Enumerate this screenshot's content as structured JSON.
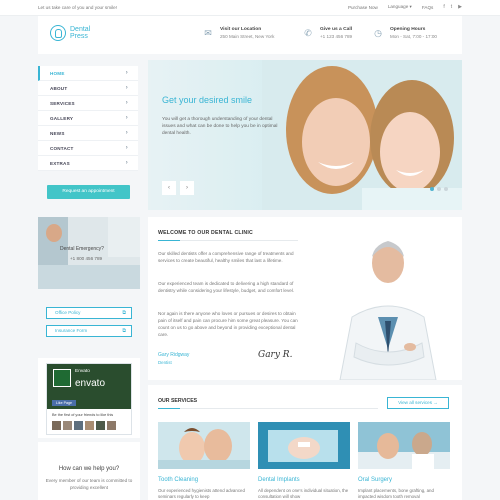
{
  "topbar": {
    "tagline": "Let us take care of you and your smile!",
    "purchase": "Purchase Now",
    "language": "Language",
    "faqs": "FAQs"
  },
  "header": {
    "logo_line1": "Dental",
    "logo_line2": "Press",
    "location_title": "Visit our Location",
    "location_value": "250 Main Street, New York",
    "call_title": "Give us a Call",
    "call_value": "+1 123 456 789",
    "hours_title": "Opening Hours",
    "hours_value": "Mon - Sat, 7:00 - 17:00"
  },
  "nav": {
    "items": [
      {
        "label": "HOME"
      },
      {
        "label": "ABOUT"
      },
      {
        "label": "SERVICES"
      },
      {
        "label": "GALLERY"
      },
      {
        "label": "NEWS"
      },
      {
        "label": "CONTACT"
      },
      {
        "label": "EXTRAS"
      }
    ]
  },
  "appointment_label": "Request an appointment",
  "slider": {
    "heading": "Get your desired smile",
    "text": "You will get a thorough understanding of your dental issues and what can be done to help you be in optimal dental health.",
    "slide_current": 1,
    "slide_total": 3
  },
  "emergency": {
    "label": "Dental Emergency?",
    "phone": "+1 800 456 789"
  },
  "links": {
    "office_policy": "Office Policy",
    "insurance_form": "Insurance Form"
  },
  "facebook": {
    "page_name": "Envato",
    "cover_text": "envato",
    "like_label": "Like Page",
    "friends_text": "Be the first of your friends to like this"
  },
  "help": {
    "title": "How can we help you?",
    "text": "Every member of our team is committed to providing excellent"
  },
  "welcome": {
    "title": "WELCOME TO OUR DENTAL CLINIC",
    "p1": "Our skilled dentists offer a comprehensive range of treatments and services to create beautiful, healthy smiles that last a lifetime.",
    "p2": "Our experienced team is dedicated to delivering a high standard of dentistry while considering your lifestyle, budget, and comfort level.",
    "p3": "Nor again is there anyone who loves or pursues or desires to obtain pain of itself and pain can procure him some great pleasure. You can count on us to go above and beyond in providing exceptional dental care.",
    "signature_name": "Gary Ridgway",
    "signature_role": "Dentist",
    "signature_script": "Gary R."
  },
  "services": {
    "title": "OUR SERVICES",
    "all_button": "View all services",
    "cards": [
      {
        "title": "Tooth Cleaning",
        "desc": "Our experienced hygienists attend advanced seminars regularly to keep"
      },
      {
        "title": "Dental Implants",
        "desc": "All dependent on one's individual situation, the consultation will show"
      },
      {
        "title": "Oral Surgery",
        "desc": "Implant placements, bone grafting, and impacted wisdom tooth removal"
      }
    ]
  },
  "colors": {
    "accent": "#39b5d4",
    "button": "#42c5c8",
    "page_bg": "#f4f6f8"
  }
}
